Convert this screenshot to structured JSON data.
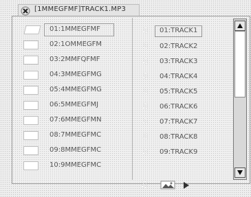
{
  "window": {
    "title": "[1MMEGFMF]TRACK1.MP3"
  },
  "folders": [
    {
      "label": "01:1MMEGFMF"
    },
    {
      "label": "02:1OMMEGFM"
    },
    {
      "label": "03:2MMFQFMF"
    },
    {
      "label": "04:3MMEGFMG"
    },
    {
      "label": "05:4MMEGFMG"
    },
    {
      "label": "06:5MMEGFMJ"
    },
    {
      "label": "07:6MMEGFMN"
    },
    {
      "label": "08:7MMEGFMC"
    },
    {
      "label": "09:8MMEGFMC"
    },
    {
      "label": "10:9MMEGFMC"
    }
  ],
  "tracks": [
    {
      "label": "01:TRACK1"
    },
    {
      "label": "02:TRACK2"
    },
    {
      "label": "03:TRACK3"
    },
    {
      "label": "04:TRACK4"
    },
    {
      "label": "05:TRACK5"
    },
    {
      "label": "06:TRACK6"
    },
    {
      "label": "07:TRACK7"
    },
    {
      "label": "08:TRACK8"
    },
    {
      "label": "09:TRACK9"
    }
  ],
  "selection": {
    "folder_index": 0,
    "track_index": 0
  },
  "scroll": {
    "position": 0.0,
    "visible_fraction": 0.41
  },
  "icons": {
    "close": "close-x-icon",
    "folder": "folder-icon",
    "track": "music-note-icon",
    "bottom": [
      "music-note-icon",
      "picture-icon",
      "play-icon"
    ]
  }
}
